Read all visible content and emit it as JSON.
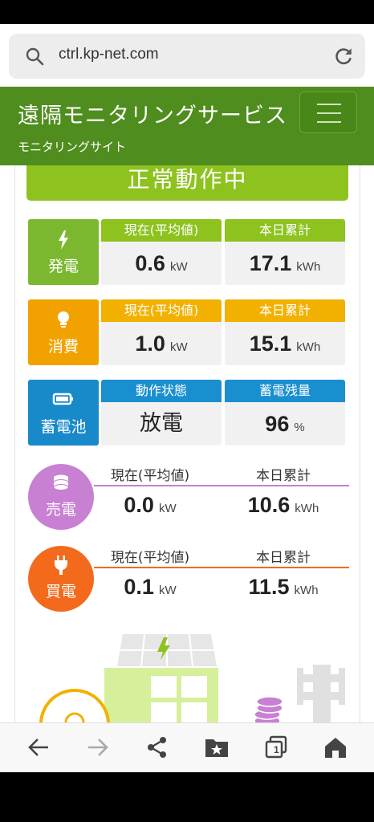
{
  "browser": {
    "url": "ctrl.kp-net.com",
    "tab_count": "1"
  },
  "header": {
    "title": "遠隔モニタリングサービス",
    "subtitle": "モニタリングサイト"
  },
  "status": "正常動作中",
  "generation": {
    "label": "発電",
    "col1_head": "現在(平均値)",
    "col1_value": "0.6",
    "col1_unit": "kW",
    "col2_head": "本日累計",
    "col2_value": "17.1",
    "col2_unit": "kWh"
  },
  "consumption": {
    "label": "消費",
    "col1_head": "現在(平均値)",
    "col1_value": "1.0",
    "col1_unit": "kW",
    "col2_head": "本日累計",
    "col2_value": "15.1",
    "col2_unit": "kWh"
  },
  "battery": {
    "label": "蓄電池",
    "col1_head": "動作状態",
    "col1_value": "放電",
    "col2_head": "蓄電残量",
    "col2_value": "96",
    "col2_unit": "%"
  },
  "selling": {
    "label": "売電",
    "col1_head": "現在(平均値)",
    "col1_value": "0.0",
    "col1_unit": "kW",
    "col2_head": "本日累計",
    "col2_value": "10.6",
    "col2_unit": "kWh"
  },
  "buying": {
    "label": "買電",
    "col1_head": "現在(平均値)",
    "col1_value": "0.1",
    "col1_unit": "kW",
    "col2_head": "本日累計",
    "col2_value": "11.5",
    "col2_unit": "kWh"
  },
  "colors": {
    "header_green": "#4f8d1e",
    "generation": "#8dc21f",
    "consumption": "#f2b100",
    "battery": "#1a8fd0",
    "selling": "#c780d2",
    "buying": "#f36a1c"
  }
}
